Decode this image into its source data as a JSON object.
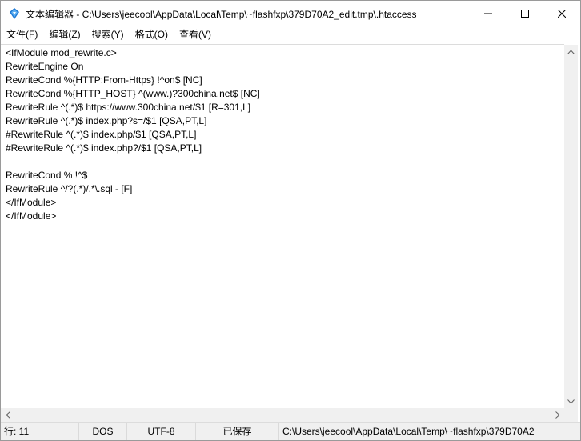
{
  "window": {
    "title": "文本编辑器 - C:\\Users\\jeecool\\AppData\\Local\\Temp\\~flashfxp\\379D70A2_edit.tmp\\.htaccess",
    "icon": "flashfxp-app-icon",
    "controls": [
      "minimize-icon",
      "maximize-icon",
      "close-icon"
    ]
  },
  "menu": {
    "items": [
      {
        "label": "文件(F)"
      },
      {
        "label": "编辑(Z)"
      },
      {
        "label": "搜索(Y)"
      },
      {
        "label": "格式(O)"
      },
      {
        "label": "查看(V)"
      }
    ]
  },
  "editor": {
    "lines": [
      "<IfModule mod_rewrite.c>",
      "RewriteEngine On",
      "RewriteCond %{HTTP:From-Https} !^on$ [NC]",
      "RewriteCond %{HTTP_HOST} ^(www.)?300china.net$ [NC]",
      "RewriteRule ^(.*)$ https://www.300china.net/$1 [R=301,L]",
      "RewriteRule ^(.*)$ index.php?s=/$1 [QSA,PT,L]",
      "#RewriteRule ^(.*)$ index.php/$1 [QSA,PT,L]",
      "#RewriteRule ^(.*)$ index.php?/$1 [QSA,PT,L]",
      "",
      "RewriteCond % !^$",
      "RewriteRule ^/?(.*)/.*\\.sql - [F]",
      "</IfModule>",
      "</IfModule>"
    ],
    "caret_line": 11
  },
  "status": {
    "line": "行: 11",
    "eol": "DOS",
    "encoding": "UTF-8",
    "saved": "已保存",
    "path": "C:\\Users\\jeecool\\AppData\\Local\\Temp\\~flashfxp\\379D70A2"
  },
  "colors": {
    "app_icon_blue": "#1e7ad6",
    "chrome_bg": "#f0f0f0"
  }
}
